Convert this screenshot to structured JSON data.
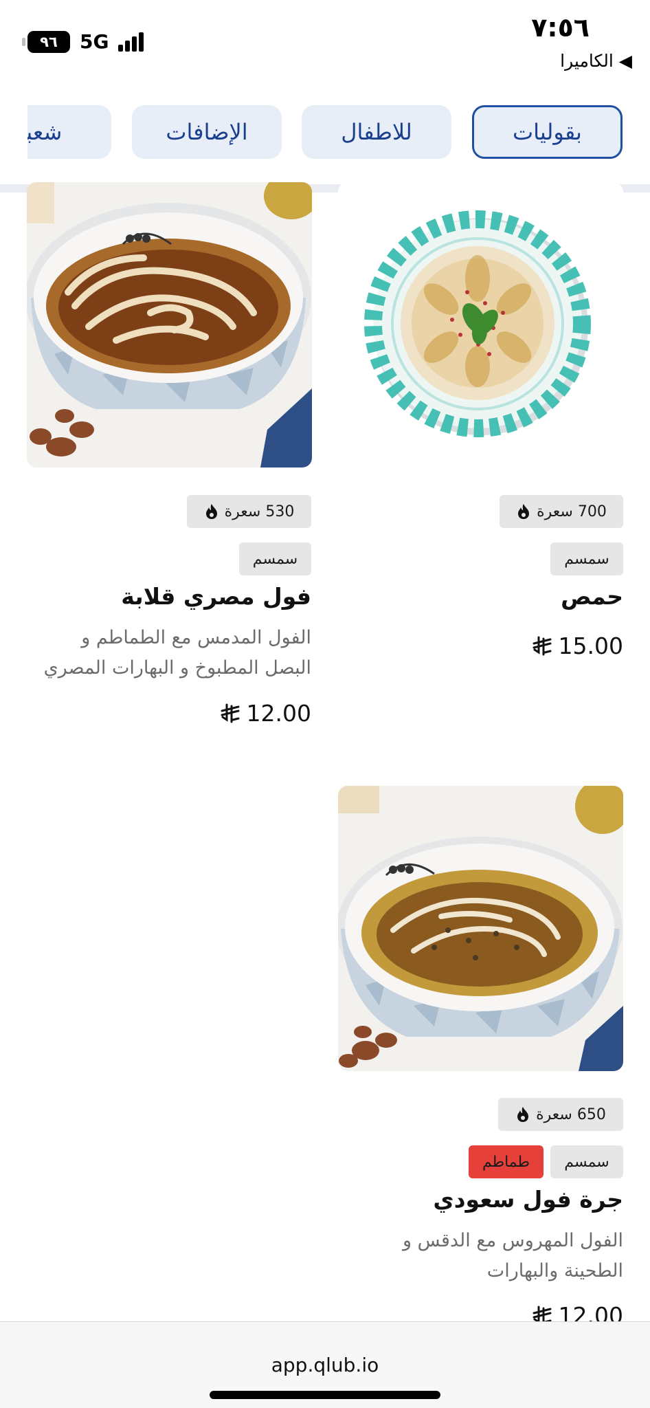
{
  "status_bar": {
    "time": "٧:٥٦",
    "back_app": "◀ الكاميرا",
    "battery": "٩٦",
    "network": "5G"
  },
  "categories": [
    {
      "label": "بقوليات",
      "active": true
    },
    {
      "label": "للاطفال",
      "active": false
    },
    {
      "label": "الإضافات",
      "active": false
    },
    {
      "label": "شعبي",
      "active": false
    }
  ],
  "menu": {
    "currency_icon": "saudi-riyal-icon",
    "items": [
      {
        "name": "حمص",
        "calories": "700 سعرة",
        "tags": [
          "سمسم"
        ],
        "description_lines": [],
        "price": "15.00",
        "image": "hummus-plate"
      },
      {
        "name": "فول مصري قلابة",
        "calories": "530 سعرة",
        "tags": [
          "سمسم"
        ],
        "description_lines": [
          "الفول المدمس مع الطماطم و",
          "البصل المطبوخ و البهارات المصري"
        ],
        "price": "12.00",
        "image": "foul-bowl"
      },
      {
        "name": "جرة فول سعودي",
        "calories": "650 سعرة",
        "tags": [
          "سمسم",
          "طماطم"
        ],
        "description_lines": [
          "الفول المهروس مع الدقس و",
          "الطحينة والبهارات"
        ],
        "price": "12.00",
        "image": "foul-bowl"
      }
    ]
  },
  "colors": {
    "accent": "#1d4fa3",
    "tab_bg": "#e8eef7",
    "tag_alert": "#e5403a"
  },
  "browser": {
    "url": "app.qlub.io"
  }
}
